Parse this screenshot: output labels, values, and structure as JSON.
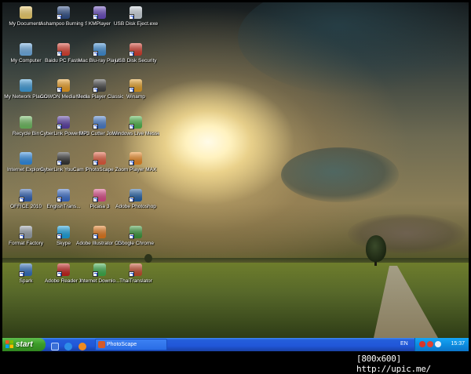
{
  "desktop_icons": [
    {
      "id": "my-documents",
      "label": "My Documents",
      "icon": "folder-documents-icon",
      "color": "#f4d26b",
      "shortcut": false
    },
    {
      "id": "ashampoo",
      "label": "Ashampoo Burning Stu...",
      "icon": "burning-flame-icon",
      "color": "#2f4f8a",
      "shortcut": true
    },
    {
      "id": "kmplayer",
      "label": "KMPlayer",
      "icon": "kmplayer-icon",
      "color": "#6a4bc2",
      "shortcut": true
    },
    {
      "id": "usb-eject",
      "label": "USB Disk Eject.exe",
      "icon": "usb-eject-icon",
      "color": "#cfd8e0",
      "shortcut": true
    },
    {
      "id": "my-computer",
      "label": "My Computer",
      "icon": "computer-icon",
      "color": "#6fb0e8",
      "shortcut": false
    },
    {
      "id": "baidu",
      "label": "Baidu PC Faster",
      "icon": "baidu-shield-icon",
      "color": "#e04030",
      "shortcut": true
    },
    {
      "id": "mac-bluray",
      "label": "Mac Blu-ray Player",
      "icon": "bluray-disc-icon",
      "color": "#3d8fd8",
      "shortcut": true
    },
    {
      "id": "usb-security",
      "label": "USB Disk Security",
      "icon": "shield-icon",
      "color": "#d83a2a",
      "shortcut": true
    },
    {
      "id": "my-network",
      "label": "My Network Places",
      "icon": "network-globe-icon",
      "color": "#3fa0e0",
      "shortcut": false
    },
    {
      "id": "cowon",
      "label": "COWON Media Center - jet...",
      "icon": "cowon-icon",
      "color": "#f0a020",
      "shortcut": true
    },
    {
      "id": "mpc",
      "label": "Media Player Classic",
      "icon": "film-clapper-icon",
      "color": "#444444",
      "shortcut": true
    },
    {
      "id": "winamp",
      "label": "Winamp",
      "icon": "winamp-icon",
      "color": "#e8a020",
      "shortcut": true
    },
    {
      "id": "recycle-bin",
      "label": "Recycle Bin",
      "icon": "recycle-bin-icon",
      "color": "#6fbf60",
      "shortcut": false
    },
    {
      "id": "powerdvd",
      "label": "CyberLink PowerDVD 12",
      "icon": "powerdvd-icon",
      "color": "#5a3da8",
      "shortcut": true
    },
    {
      "id": "mp3-cutter",
      "label": "MP3 Cutter Joiner",
      "icon": "scissors-note-icon",
      "color": "#4a7fd0",
      "shortcut": true
    },
    {
      "id": "live-messenger",
      "label": "Windows Live Messenger",
      "icon": "messenger-buddy-icon",
      "color": "#4fb84a",
      "shortcut": true
    },
    {
      "id": "ie",
      "label": "Internet Explorer",
      "icon": "internet-explorer-icon",
      "color": "#2e8ee8",
      "shortcut": false
    },
    {
      "id": "youcam",
      "label": "CyberLink YouCam 5",
      "icon": "webcam-icon",
      "color": "#333333",
      "shortcut": true
    },
    {
      "id": "photoscape",
      "label": "PhotoScape",
      "icon": "photoscape-icon",
      "color": "#e85a3a",
      "shortcut": true
    },
    {
      "id": "zoom-player",
      "label": "Zoom Player MAX",
      "icon": "play-circle-icon",
      "color": "#f08a20",
      "shortcut": true
    },
    {
      "id": "office",
      "label": "OFFICE 2010",
      "icon": "word-document-icon",
      "color": "#2b5fb8",
      "shortcut": true
    },
    {
      "id": "englishtrans",
      "label": "EnglishTrans...",
      "icon": "abc-dictionary-icon",
      "color": "#3a6fd0",
      "shortcut": true
    },
    {
      "id": "picasa",
      "label": "Picasa 3",
      "icon": "picasa-icon",
      "color": "#e04a8a",
      "shortcut": true
    },
    {
      "id": "photoshop",
      "label": "Adobe Photoshop",
      "icon": "photoshop-icon",
      "color": "#1f5fa8",
      "shortcut": true
    },
    {
      "id": "format-factory",
      "label": "Format Factory",
      "icon": "gears-icon",
      "color": "#9aa3ad",
      "shortcut": true
    },
    {
      "id": "skype",
      "label": "Skype",
      "icon": "skype-icon",
      "color": "#16a4e4",
      "shortcut": true
    },
    {
      "id": "illustrator",
      "label": "Adobe Illustrator CS5",
      "icon": "illustrator-icon",
      "color": "#e87a1a",
      "shortcut": true
    },
    {
      "id": "chrome",
      "label": "Google Chrome",
      "icon": "chrome-icon",
      "color": "#3a9a3a",
      "shortcut": true
    },
    {
      "id": "spark",
      "label": "Spark",
      "icon": "spark-icon",
      "color": "#2f6fc0",
      "shortcut": true
    },
    {
      "id": "adobe-reader",
      "label": "Adobe Reader X",
      "icon": "pdf-reader-icon",
      "color": "#c8201a",
      "shortcut": true
    },
    {
      "id": "idm",
      "label": "Internet Downlo...",
      "icon": "download-globe-icon",
      "color": "#3ab04a",
      "shortcut": true
    },
    {
      "id": "thaitranslator",
      "label": "ThaiTranslator",
      "icon": "translator-book-icon",
      "color": "#c84a2a",
      "shortcut": true
    }
  ],
  "taskbar": {
    "start_label": "start",
    "active_task": "PhotoScape",
    "language": "EN",
    "clock": "15:37"
  },
  "caption": "[800x600] http://upic.me/"
}
